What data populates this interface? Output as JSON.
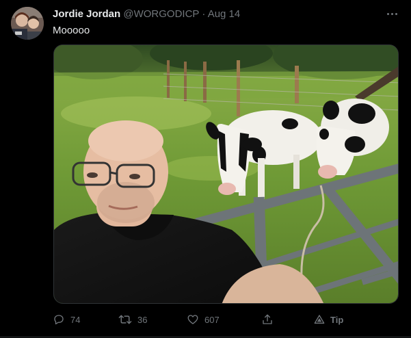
{
  "tweet": {
    "author_name": "Jordie Jordan",
    "handle": "@WORGODICP",
    "separator": "·",
    "date": "Aug 14",
    "text": "Mooooo",
    "media_icon": "photo-selfie-with-cows",
    "more_icon": "more-horizontal-icon"
  },
  "actions": {
    "reply_count": "74",
    "retweet_count": "36",
    "like_count": "607",
    "tip_label": "Tip",
    "icons": [
      "reply-icon",
      "retweet-icon",
      "like-icon",
      "share-icon",
      "tip-icon"
    ]
  },
  "colors": {
    "background": "#000000",
    "text_primary": "#e7e9ea",
    "text_secondary": "#71767b",
    "border": "#2f3336"
  }
}
